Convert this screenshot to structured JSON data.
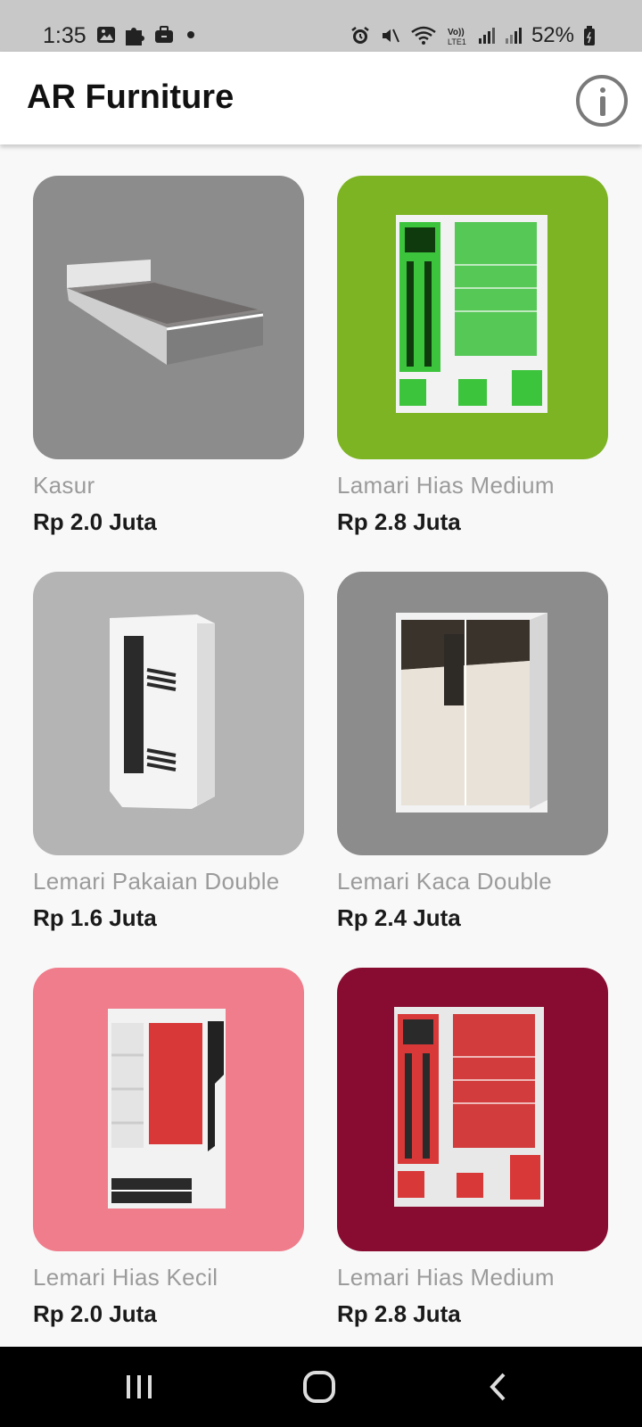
{
  "status_bar": {
    "time": "1:35",
    "battery": "52%",
    "left_icons": [
      "gallery-icon",
      "puzzle-icon",
      "briefcase-icon",
      "dot-icon"
    ],
    "right_icons": [
      "alarm-icon",
      "mute-icon",
      "wifi-icon",
      "volte-icon",
      "signal-icon",
      "signal-icon",
      "battery-icon"
    ]
  },
  "app_bar": {
    "title": "AR Furniture",
    "info_icon": "info-icon"
  },
  "products": [
    {
      "name": "Kasur",
      "price": "Rp 2.0 Juta",
      "bg": "#8c8c8c"
    },
    {
      "name": "Lamari Hias Medium",
      "price": "Rp 2.8 Juta",
      "bg": "#7db424"
    },
    {
      "name": "Lemari Pakaian Double",
      "price": "Rp 1.6 Juta",
      "bg": "#b4b4b4"
    },
    {
      "name": "Lemari Kaca Double",
      "price": "Rp 2.4 Juta",
      "bg": "#8c8c8c"
    },
    {
      "name": "Lemari Hias Kecil",
      "price": "Rp 2.0 Juta",
      "bg": "#ef7d8c"
    },
    {
      "name": "Lemari Hias Medium",
      "price": "Rp 2.8 Juta",
      "bg": "#880c31"
    }
  ],
  "nav_bar": {
    "buttons": [
      "recents-icon",
      "home-icon",
      "back-icon"
    ]
  }
}
